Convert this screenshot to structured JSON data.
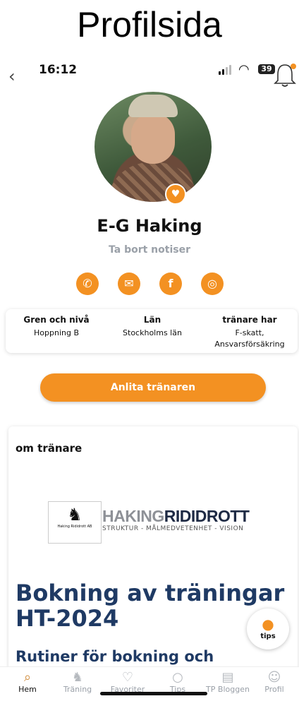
{
  "page_title": "Profilsida",
  "status_bar": {
    "time": "16:12",
    "battery": "39"
  },
  "profile": {
    "name": "E-G Haking",
    "notify_toggle": "Ta bort notiser",
    "socials": [
      {
        "name": "phone-icon",
        "glyph": "✆"
      },
      {
        "name": "mail-icon",
        "glyph": "✉"
      },
      {
        "name": "facebook-icon",
        "glyph": "f"
      },
      {
        "name": "instagram-icon",
        "glyph": "◎"
      }
    ]
  },
  "info": {
    "branch_label": "Gren och nivå",
    "branch_value": "Hoppning B",
    "county_label": "Län",
    "county_value": "Stockholms län",
    "trainer_label": "tränare har",
    "trainer_value_1": "F-skatt,",
    "trainer_value_2": "Ansvarsförsäkring"
  },
  "hire_button": "Anlita tränaren",
  "about": {
    "title": "om tränare",
    "logo_small": "Haking Rididrott AB",
    "logo_part1": "HAKING",
    "logo_part2": "RIDIDROTT",
    "logo_sub": "STRUKTUR - MÅLMEDVETENHET - VISION",
    "heading_line1": "Bokning av träningar",
    "heading_line2": "HT-2024",
    "sub_heading": "Rutiner för bokning och betalning"
  },
  "tips_button": "tips",
  "tabs": [
    {
      "label": "Hem",
      "active": true
    },
    {
      "label": "Träning"
    },
    {
      "label": "Favoriter"
    },
    {
      "label": "Tips"
    },
    {
      "label": "TP Bloggen"
    },
    {
      "label": "Profil"
    }
  ],
  "colors": {
    "accent": "#f39122",
    "heading": "#1f3a64"
  }
}
